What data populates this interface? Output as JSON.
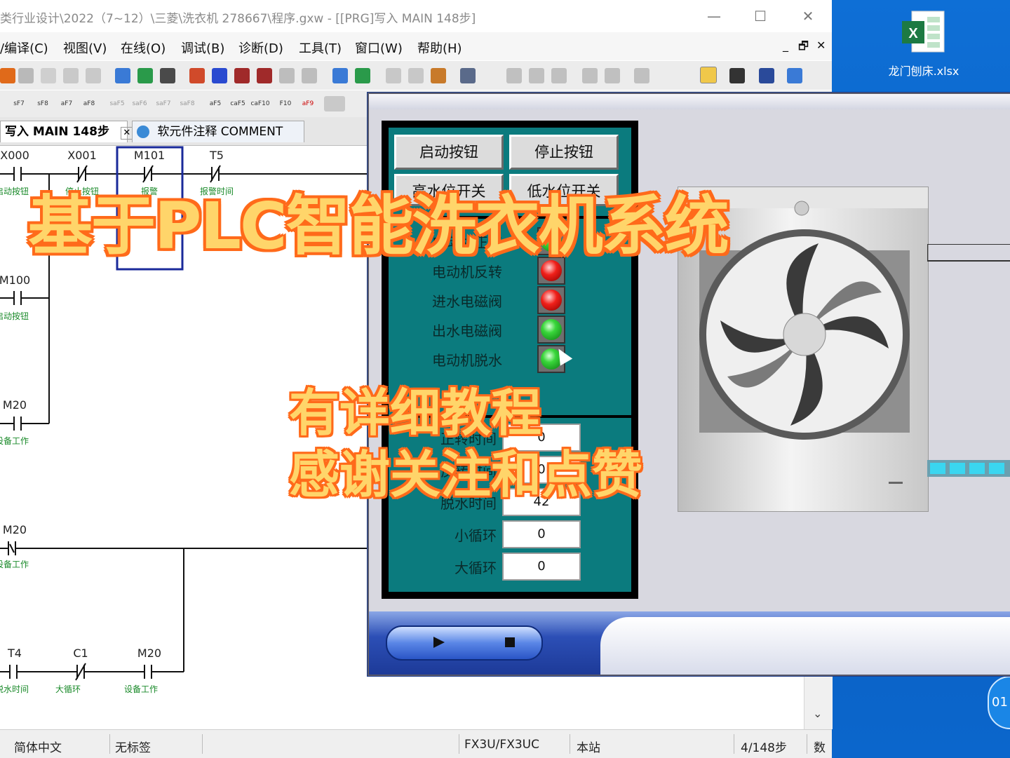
{
  "window": {
    "title": "类行业设计\\2022（7~12）\\三菱\\洗衣机  278667\\程序.gxw - [[PRG]写入 MAIN 148步]"
  },
  "menu": [
    "/编译(C)",
    "视图(V)",
    "在线(O)",
    "调试(B)",
    "诊断(D)",
    "工具(T)",
    "窗口(W)",
    "帮助(H)"
  ],
  "softkeys": [
    "sF7",
    "sF8",
    "aF7",
    "aF8",
    "saF5",
    "saF6",
    "saF7",
    "saF8",
    "aF5",
    "caF5",
    "caF10",
    "F10",
    "aF9"
  ],
  "tabs": [
    {
      "label": "写入 MAIN 148步"
    },
    {
      "label": "软元件注释 COMMENT"
    }
  ],
  "ladder": {
    "row1": [
      {
        "dev": "X000",
        "comment": "启动按钮"
      },
      {
        "dev": "X001",
        "comment": "停止按钮"
      },
      {
        "dev": "M101",
        "comment": "报警"
      },
      {
        "dev": "T5",
        "comment": "报警时间"
      }
    ],
    "row1_flag": "Z",
    "m100": {
      "dev": "M100",
      "comment": "启动按钮"
    },
    "m20a": {
      "dev": "M20",
      "comment": "设备工作"
    },
    "m20b": {
      "dev": "M20",
      "comment": "设备工作"
    },
    "row5": [
      {
        "dev": "T4",
        "comment": "脱水时间"
      },
      {
        "dev": "C1",
        "comment": "大循环"
      },
      {
        "dev": "M20",
        "comment": "设备工作"
      }
    ]
  },
  "status": {
    "lang": "简体中文",
    "label": "无标签",
    "cpu": "FX3U/FX3UC",
    "station": "本站",
    "steps": "4/148步",
    "extra": "数"
  },
  "desktop": {
    "file_label": "龙门刨床.xlsx",
    "clock": "01"
  },
  "hmi": {
    "start_btn": "启动按钮",
    "stop_btn": "停止按钮",
    "btn3": "高水位开关",
    "btn4": "低水位开关",
    "indicators": [
      {
        "label": "电动机正转",
        "state": "green"
      },
      {
        "label": "电动机反转",
        "state": "red"
      },
      {
        "label": "进水电磁阀",
        "state": "red"
      },
      {
        "label": "出水电磁阀",
        "state": "green"
      },
      {
        "label": "电动机脱水",
        "state": "green"
      }
    ],
    "values": [
      {
        "label": "正转时间",
        "value": "0"
      },
      {
        "label": "反转时间",
        "value": "0"
      },
      {
        "label": "脱水时间",
        "value": "42"
      },
      {
        "label": "小循环",
        "value": "0"
      },
      {
        "label": "大循环",
        "value": "0"
      }
    ]
  },
  "overlay": {
    "title": "基于PLC智能洗衣机系统",
    "line1": "有详细教程",
    "line2": "感谢关注和点赞"
  },
  "colors": {
    "accent_orange": "#ff6a1a",
    "overlay_text": "#ffd56a",
    "hmi_teal": "#0b7b7e"
  }
}
